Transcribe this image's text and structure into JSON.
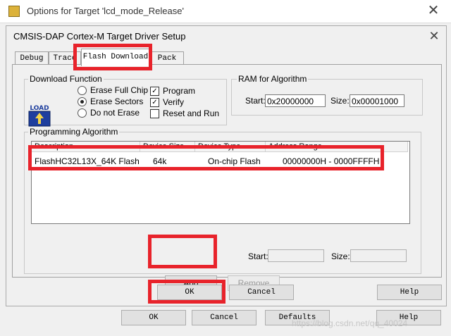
{
  "outer_window": {
    "title": "Options for Target 'lcd_mode_Release'",
    "close_glyph": "✕",
    "buttons": {
      "ok": "OK",
      "cancel": "Cancel",
      "defaults": "Defaults",
      "help": "Help"
    }
  },
  "dialog": {
    "title": "CMSIS-DAP Cortex-M Target Driver Setup",
    "close_glyph": "✕",
    "tabs": [
      {
        "label": "Debug",
        "active": false
      },
      {
        "label": "Trace",
        "active": false
      },
      {
        "label": "Flash Download",
        "active": true
      },
      {
        "label": "Pack",
        "active": false
      }
    ],
    "download_function": {
      "label": "Download Function",
      "icon": "load-icon",
      "icon_text": "LOAD",
      "radios": [
        {
          "label": "Erase Full Chip",
          "selected": false
        },
        {
          "label": "Erase Sectors",
          "selected": true
        },
        {
          "label": "Do not Erase",
          "selected": false
        }
      ],
      "checkboxes": [
        {
          "label": "Program",
          "checked": true
        },
        {
          "label": "Verify",
          "checked": true
        },
        {
          "label": "Reset and Run",
          "checked": false
        }
      ]
    },
    "ram_for_algorithm": {
      "label": "RAM for Algorithm",
      "start_label": "Start:",
      "start_value": "0x20000000",
      "size_label": "Size:",
      "size_value": "0x00001000"
    },
    "programming_algorithm": {
      "label": "Programming Algorithm",
      "columns": [
        "Description",
        "Device Size",
        "Device Type",
        "Address Range"
      ],
      "rows": [
        {
          "description": "FlashHC32L13X_64K Flash",
          "device_size": "64k",
          "device_type": "On-chip Flash",
          "address_range": "00000000H - 0000FFFFH"
        }
      ],
      "start_label": "Start:",
      "start_value": "",
      "size_label": "Size:",
      "size_value": ""
    },
    "buttons": {
      "add": "Add",
      "remove": "Remove",
      "ok": "OK",
      "cancel": "Cancel",
      "help": "Help"
    }
  },
  "watermark": "https://blog.csdn.net/qq_40024",
  "colors": {
    "highlight_red": "#e8232b",
    "window_bg": "#f0f0f0",
    "button_bg": "#e1e1e1"
  }
}
